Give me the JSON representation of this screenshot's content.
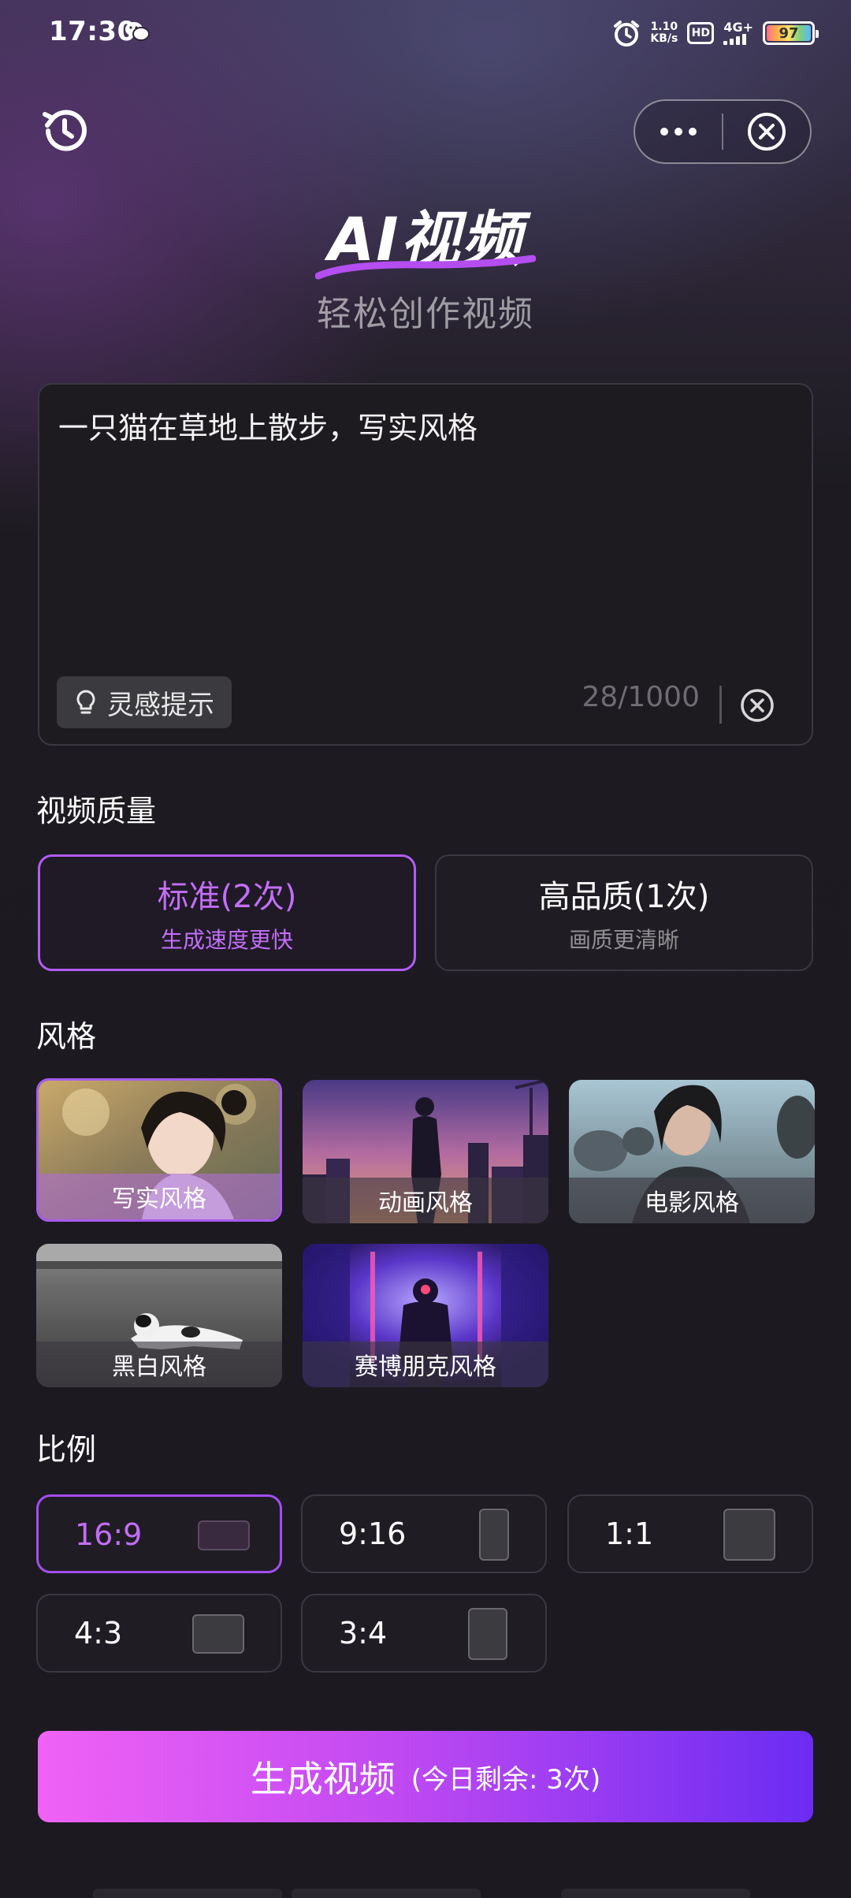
{
  "status_bar": {
    "time": "17:30",
    "net_speed_value": "1.10",
    "net_speed_unit": "KB/s",
    "hd_label": "HD",
    "network_label": "4G+",
    "battery_level": "97"
  },
  "header": {
    "title": "AI视频",
    "subtitle": "轻松创作视频"
  },
  "prompt": {
    "text": "一只猫在草地上散步，写实风格",
    "inspiration_label": "灵感提示",
    "char_count": "28/1000"
  },
  "quality": {
    "section_label": "视频质量",
    "options": [
      {
        "title": "标准(2次)",
        "subtitle": "生成速度更快",
        "selected": true
      },
      {
        "title": "高品质(1次)",
        "subtitle": "画质更清晰",
        "selected": false
      }
    ]
  },
  "style": {
    "section_label": "风格",
    "options": [
      {
        "label": "写实风格",
        "selected": true
      },
      {
        "label": "动画风格",
        "selected": false
      },
      {
        "label": "电影风格",
        "selected": false
      },
      {
        "label": "黑白风格",
        "selected": false
      },
      {
        "label": "赛博朋克风格",
        "selected": false
      }
    ]
  },
  "ratio": {
    "section_label": "比例",
    "options": [
      {
        "label": "16:9",
        "selected": true
      },
      {
        "label": "9:16",
        "selected": false
      },
      {
        "label": "1:1",
        "selected": false
      },
      {
        "label": "4:3",
        "selected": false
      },
      {
        "label": "3:4",
        "selected": false
      }
    ]
  },
  "generate": {
    "label": "生成视频",
    "remaining": "(今日剩余: 3次)"
  },
  "colors": {
    "accent": "#b25cf5",
    "gradient_start": "#f062f5",
    "gradient_end": "#6b2cf2",
    "background": "#1c1a20"
  }
}
